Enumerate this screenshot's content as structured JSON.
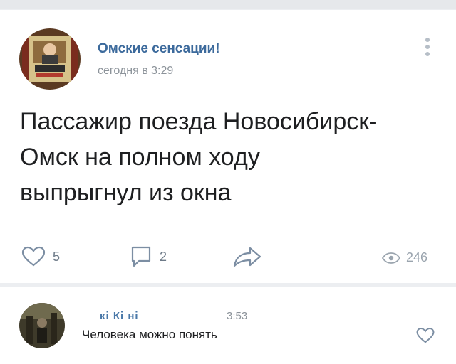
{
  "post": {
    "author": "Омские сенсации!",
    "time": "сегодня в 3:29",
    "text_lines": [
      "Пассажир поезда Новосибирск-",
      "Омск на полном ходу",
      "выпрыгнул из окна"
    ],
    "likes": "5",
    "comments": "2",
    "views": "246",
    "icons": {
      "menu": "more-vertical-icon",
      "like": "heart-icon",
      "comment": "comment-icon",
      "share": "share-icon",
      "views": "eye-icon"
    }
  },
  "comment": {
    "author": "кі   Кі   ні",
    "time": "3:53",
    "text": "Человека можно понять"
  },
  "colors": {
    "link": "#3c6a9c",
    "muted": "#8c939a",
    "icon": "#7c8ea3"
  }
}
